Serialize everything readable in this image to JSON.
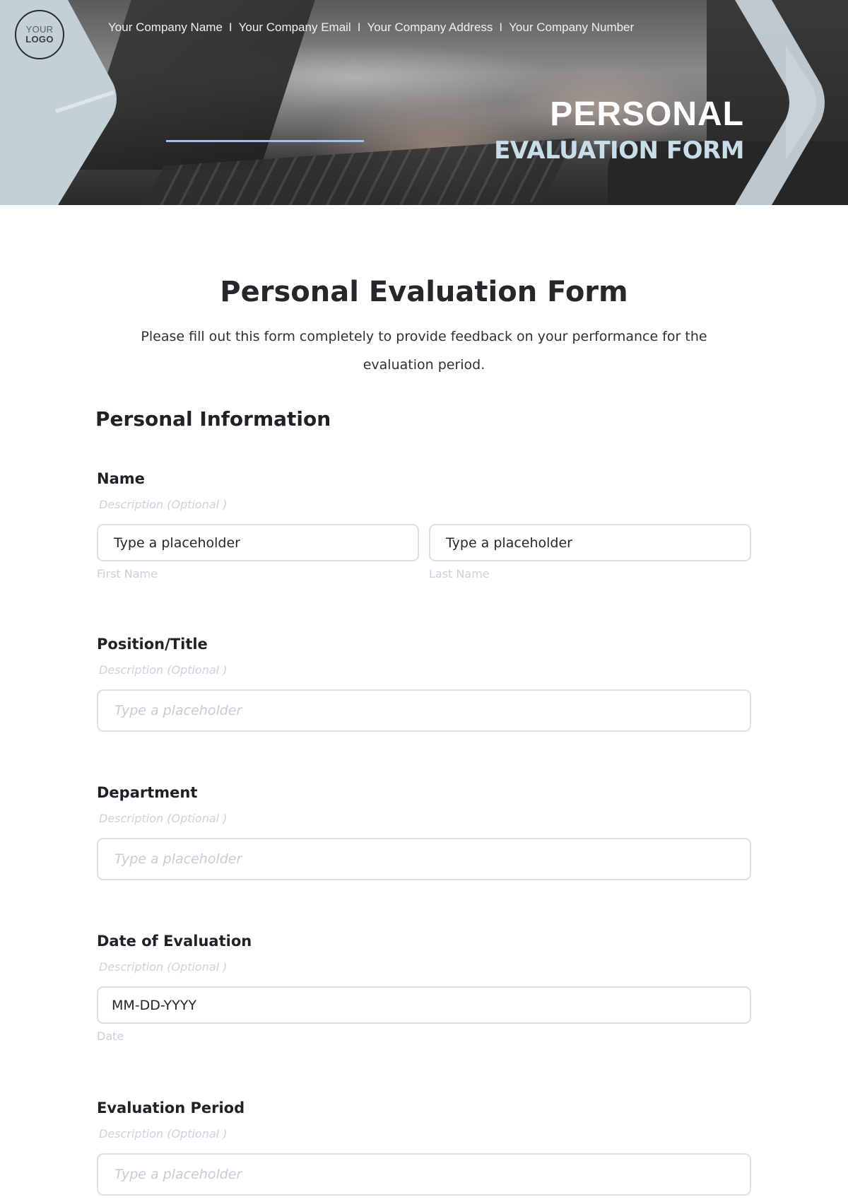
{
  "header": {
    "logo": {
      "line1": "YOUR",
      "line2": "LOGO"
    },
    "company_info": [
      "Your Company Name",
      "Your Company Email",
      "Your Company Address",
      "Your Company Number"
    ],
    "separator": "I",
    "hero_title_line1": "PERSONAL",
    "hero_title_line2": "EVALUATION FORM",
    "colors": {
      "accent_line": "#9ec0f5",
      "chevron": "#c4d0d8",
      "hero_subtitle": "#c9dde8"
    }
  },
  "form": {
    "title": "Personal Evaluation Form",
    "intro": "Please fill out this form completely to provide feedback on your performance for the evaluation period.",
    "section_heading": "Personal Information",
    "fields": [
      {
        "label": "Name",
        "description": "Description  (Optional )",
        "inputs": [
          {
            "value": "Type a placeholder",
            "sublabel": "First Name"
          },
          {
            "value": "Type a placeholder",
            "sublabel": "Last Name"
          }
        ]
      },
      {
        "label": "Position/Title",
        "description": "Description  (Optional )",
        "placeholder": "Type a placeholder"
      },
      {
        "label": "Department",
        "description": "Description  (Optional )",
        "placeholder": "Type a placeholder"
      },
      {
        "label": "Date of Evaluation",
        "description": "Description  (Optional )",
        "value": "MM-DD-YYYY",
        "sublabel": "Date"
      },
      {
        "label": "Evaluation Period",
        "description": "Description  (Optional )",
        "placeholder": "Type a placeholder"
      }
    ]
  }
}
